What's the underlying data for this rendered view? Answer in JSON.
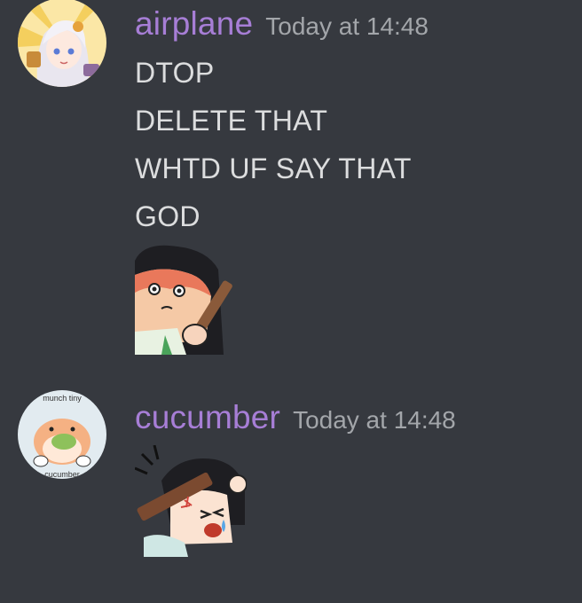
{
  "messages": [
    {
      "username": "airplane",
      "timestamp": "Today at 14:48",
      "lines": [
        "DTOP",
        "DELETE THAT",
        "WHTD UF SAY THAT",
        "GOD"
      ],
      "username_color": "#a77ed6"
    },
    {
      "username": "cucumber",
      "timestamp": "Today at 14:48",
      "username_color": "#a77ed6",
      "avatar_text_top": "munch tiny",
      "avatar_text_bottom": "cucumber"
    }
  ],
  "colors": {
    "background": "#36393f",
    "text": "#dcddde",
    "timestamp": "#a3a6aa"
  }
}
